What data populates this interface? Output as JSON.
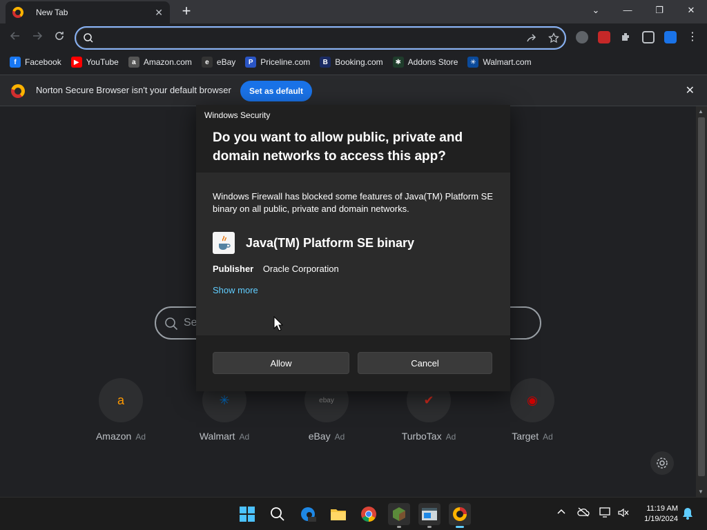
{
  "browser": {
    "tab_title": "New Tab",
    "tab_close": "✕",
    "new_tab": "+",
    "window_controls": {
      "dropdown": "⌄",
      "minimize": "—",
      "restore": "❐",
      "close": "✕"
    },
    "omnibox_value": ""
  },
  "bookmarks": [
    {
      "label": "Facebook",
      "icon": "facebook-icon",
      "badge": "f",
      "color": "#1877f2"
    },
    {
      "label": "YouTube",
      "icon": "youtube-icon",
      "badge": "▶",
      "color": "#ff0000"
    },
    {
      "label": "Amazon.com",
      "icon": "amazon-icon",
      "badge": "a",
      "color": "#555555"
    },
    {
      "label": "eBay",
      "icon": "ebay-icon",
      "badge": "e",
      "color": "#333333"
    },
    {
      "label": "Priceline.com",
      "icon": "priceline-icon",
      "badge": "P",
      "color": "#2a55c5"
    },
    {
      "label": "Booking.com",
      "icon": "booking-icon",
      "badge": "B",
      "color": "#1a2b63"
    },
    {
      "label": "Addons Store",
      "icon": "addons-store-icon",
      "badge": "✱",
      "color": "#1f3d2c"
    },
    {
      "label": "Walmart.com",
      "icon": "walmart-icon",
      "badge": "✳",
      "color": "#0b4a9a"
    }
  ],
  "infobar": {
    "message": "Norton Secure Browser isn't your default browser",
    "button": "Set as default",
    "close": "✕"
  },
  "newtab_page": {
    "search_placeholder": "Se",
    "tiles": [
      {
        "label": "Amazon",
        "ad": "Ad",
        "glyph": "a",
        "color": "#ff9900"
      },
      {
        "label": "Walmart",
        "ad": "Ad",
        "glyph": "✳",
        "color": "#0071ce"
      },
      {
        "label": "eBay",
        "ad": "Ad",
        "glyph": "ebay",
        "color": "#8a8a8a"
      },
      {
        "label": "TurboTax",
        "ad": "Ad",
        "glyph": "✔",
        "color": "#d52b1e"
      },
      {
        "label": "Target",
        "ad": "Ad",
        "glyph": "◉",
        "color": "#cc0000"
      }
    ]
  },
  "dialog": {
    "caption": "Windows Security",
    "title": "Do you want to allow public, private and domain networks to access this app?",
    "body": "Windows Firewall has blocked some features of Java(TM) Platform SE binary on all public, private and domain networks.",
    "app_name": "Java(TM) Platform SE binary",
    "publisher_label": "Publisher",
    "publisher_value": "Oracle Corporation",
    "show_more": "Show more",
    "allow": "Allow",
    "cancel": "Cancel"
  },
  "taskbar": {
    "time": "11:19 AM",
    "date": "1/19/2024"
  },
  "colors": {
    "accent_blue": "#1a73e8",
    "link_blue": "#60cdff"
  }
}
